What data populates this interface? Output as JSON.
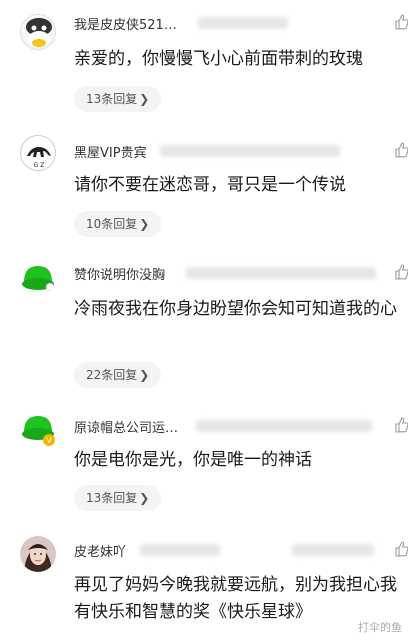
{
  "comments": [
    {
      "username": "我是皮皮侠521…",
      "text": "亲爱的，你慢慢飞小心前面带刺的玫瑰",
      "reply_label": "13条回复",
      "avatar": "panda-face-avatar"
    },
    {
      "username": "黑屋VIP贵宾",
      "text": "请你不要在迷恋哥，哥只是一个传说",
      "reply_label": "10条回复",
      "avatar": "black-bull-logo-avatar"
    },
    {
      "username": "赞你说明你没胸",
      "text": "冷雨夜我在你身边盼望你会知可知道我的心",
      "reply_label": "22条回复",
      "avatar": "green-hat-avatar"
    },
    {
      "username": "原谅帽总公司运…",
      "text": "你是电你是光，你是唯一的神话",
      "reply_label": "13条回复",
      "avatar": "green-hat-verified-avatar"
    },
    {
      "username": "皮老妹吖",
      "text": "再见了妈妈今晚我就要远航，别为我担心我有快乐和智慧的奖《快乐星球》",
      "reply_label": "",
      "avatar": "girl-photo-avatar"
    }
  ],
  "reply_chevron": "❯",
  "watermark": "打伞的鱼",
  "icons": {
    "like": "thumb-up-icon"
  },
  "colors": {
    "reply_bg": "#f4f4f4",
    "green_hat": "#1fc21f"
  }
}
